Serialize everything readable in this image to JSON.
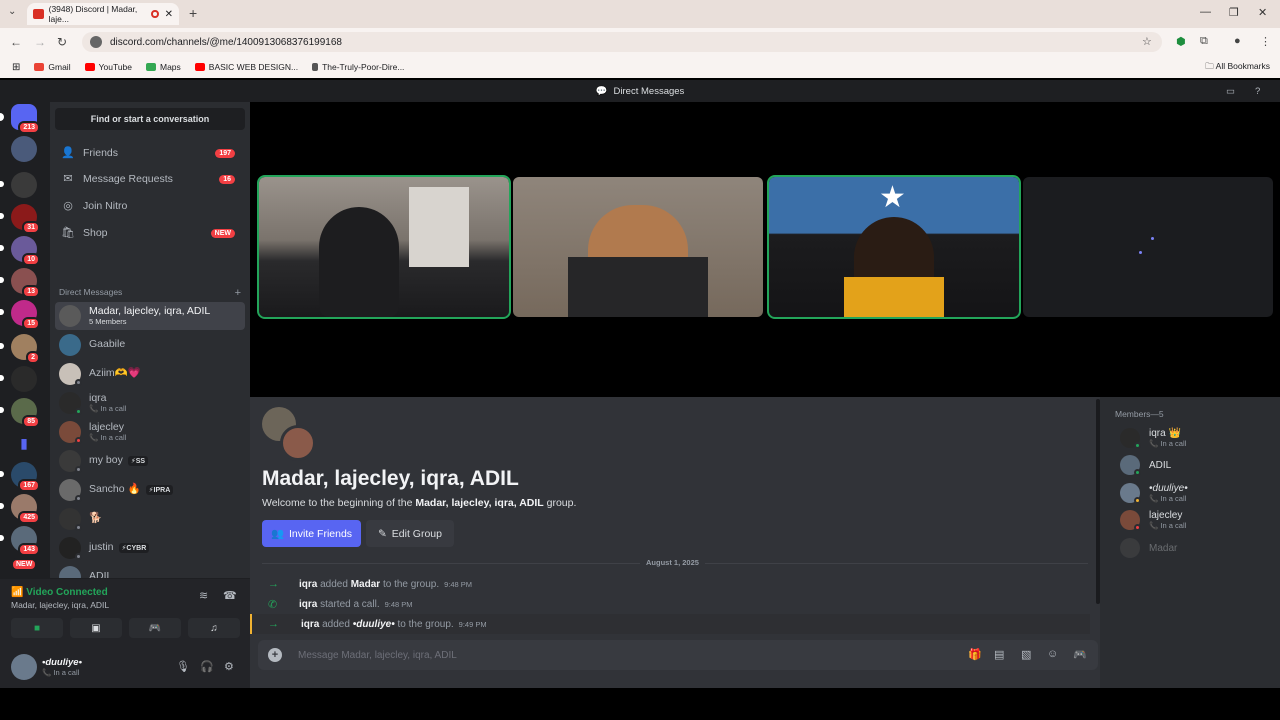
{
  "browser": {
    "tab_title": "(3948) Discord | Madar, laje...",
    "url": "discord.com/channels/@me/1400913068376199168",
    "bookmarks": [
      "Gmail",
      "YouTube",
      "Maps",
      "BASIC WEB DESIGN...",
      "The-Truly-Poor-Dire..."
    ],
    "all_bookmarks": "All Bookmarks"
  },
  "header": {
    "title": "Direct Messages"
  },
  "servers": [
    {
      "badge": "213"
    },
    {
      "badge": ""
    },
    {
      "badge": ""
    },
    {
      "badge": "31"
    },
    {
      "badge": "10"
    },
    {
      "badge": "13"
    },
    {
      "badge": "15"
    },
    {
      "badge": "2"
    },
    {
      "badge": ""
    },
    {
      "badge": "85"
    },
    {
      "badge": ""
    },
    {
      "badge": "167"
    },
    {
      "badge": "425"
    },
    {
      "badge": "143"
    },
    {
      "badge": "NEW"
    }
  ],
  "sidebar": {
    "search": "Find or start a conversation",
    "nav": [
      {
        "label": "Friends",
        "count": "197"
      },
      {
        "label": "Message Requests",
        "count": "16"
      },
      {
        "label": "Join Nitro",
        "count": ""
      },
      {
        "label": "Shop",
        "count": "NEW"
      }
    ],
    "dm_header": "Direct Messages",
    "dms": [
      {
        "name": "Madar, lajecley, iqra, ADIL",
        "sub": "5 Members",
        "tag": ""
      },
      {
        "name": "Gaabile",
        "sub": "",
        "tag": ""
      },
      {
        "name": "Aziim🫶💗",
        "sub": "",
        "tag": ""
      },
      {
        "name": "iqra",
        "sub": "In a call",
        "tag": ""
      },
      {
        "name": "lajecley",
        "sub": "In a call",
        "tag": ""
      },
      {
        "name": "my boy",
        "sub": "",
        "tag": "⚡SS"
      },
      {
        "name": "Sancho 🔥",
        "sub": "",
        "tag": "⚡IPRA"
      },
      {
        "name": "🐕",
        "sub": "",
        "tag": ""
      },
      {
        "name": "justin",
        "sub": "",
        "tag": "⚡CYBR"
      },
      {
        "name": "ADIL",
        "sub": "",
        "tag": ""
      }
    ]
  },
  "voice": {
    "status": "Video Connected",
    "channel": "Madar, lajecley, iqra, ADIL"
  },
  "user": {
    "name": "•duuliye•",
    "status": "In a call"
  },
  "chat": {
    "group_title": "Madar, lajecley, iqra, ADIL",
    "welcome_pre": "Welcome to the beginning of the ",
    "welcome_bold": "Madar, lajecley, iqra, ADIL",
    "welcome_post": " group.",
    "invite_label": "Invite Friends",
    "edit_label": "Edit Group",
    "date": "August 1, 2025",
    "messages": [
      {
        "actor": "iqra",
        "verb": " added ",
        "target": "Madar",
        "rest": " to the group.",
        "time": "9:48 PM"
      },
      {
        "actor": "iqra",
        "verb": " started a call.",
        "target": "",
        "rest": "",
        "time": "9:48 PM"
      },
      {
        "actor": "iqra",
        "verb": " added ",
        "target": "•duuliye•",
        "rest": " to the group.",
        "time": "9:49 PM"
      }
    ],
    "placeholder": "Message Madar, lajecley, iqra, ADIL"
  },
  "members": {
    "header": "Members—5",
    "list": [
      {
        "name": "iqra 👑",
        "sub": "In a call"
      },
      {
        "name": "ADIL",
        "sub": ""
      },
      {
        "name": "•duuliye•",
        "sub": "In a call"
      },
      {
        "name": "lajecley",
        "sub": "In a call"
      },
      {
        "name": "Madar",
        "sub": ""
      }
    ]
  },
  "colors": {
    "blurple": "#5865f2",
    "green": "#23a55a",
    "red": "#f23f43"
  }
}
